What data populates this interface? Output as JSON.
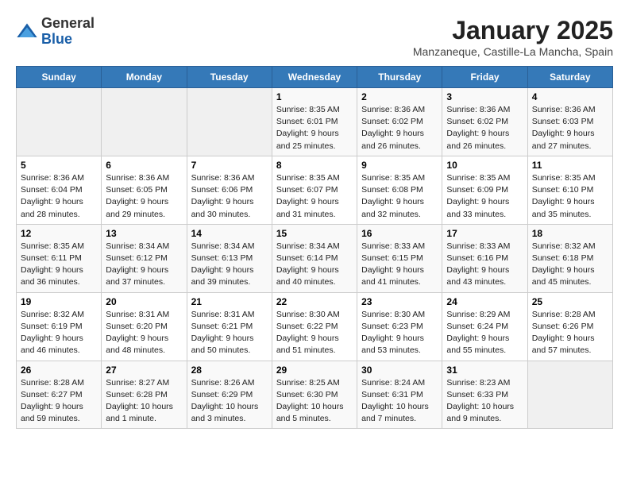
{
  "logo": {
    "general": "General",
    "blue": "Blue"
  },
  "title": "January 2025",
  "subtitle": "Manzaneque, Castille-La Mancha, Spain",
  "days_of_week": [
    "Sunday",
    "Monday",
    "Tuesday",
    "Wednesday",
    "Thursday",
    "Friday",
    "Saturday"
  ],
  "weeks": [
    [
      {
        "day": "",
        "info": ""
      },
      {
        "day": "",
        "info": ""
      },
      {
        "day": "",
        "info": ""
      },
      {
        "day": "1",
        "info": "Sunrise: 8:35 AM\nSunset: 6:01 PM\nDaylight: 9 hours\nand 25 minutes."
      },
      {
        "day": "2",
        "info": "Sunrise: 8:36 AM\nSunset: 6:02 PM\nDaylight: 9 hours\nand 26 minutes."
      },
      {
        "day": "3",
        "info": "Sunrise: 8:36 AM\nSunset: 6:02 PM\nDaylight: 9 hours\nand 26 minutes."
      },
      {
        "day": "4",
        "info": "Sunrise: 8:36 AM\nSunset: 6:03 PM\nDaylight: 9 hours\nand 27 minutes."
      }
    ],
    [
      {
        "day": "5",
        "info": "Sunrise: 8:36 AM\nSunset: 6:04 PM\nDaylight: 9 hours\nand 28 minutes."
      },
      {
        "day": "6",
        "info": "Sunrise: 8:36 AM\nSunset: 6:05 PM\nDaylight: 9 hours\nand 29 minutes."
      },
      {
        "day": "7",
        "info": "Sunrise: 8:36 AM\nSunset: 6:06 PM\nDaylight: 9 hours\nand 30 minutes."
      },
      {
        "day": "8",
        "info": "Sunrise: 8:35 AM\nSunset: 6:07 PM\nDaylight: 9 hours\nand 31 minutes."
      },
      {
        "day": "9",
        "info": "Sunrise: 8:35 AM\nSunset: 6:08 PM\nDaylight: 9 hours\nand 32 minutes."
      },
      {
        "day": "10",
        "info": "Sunrise: 8:35 AM\nSunset: 6:09 PM\nDaylight: 9 hours\nand 33 minutes."
      },
      {
        "day": "11",
        "info": "Sunrise: 8:35 AM\nSunset: 6:10 PM\nDaylight: 9 hours\nand 35 minutes."
      }
    ],
    [
      {
        "day": "12",
        "info": "Sunrise: 8:35 AM\nSunset: 6:11 PM\nDaylight: 9 hours\nand 36 minutes."
      },
      {
        "day": "13",
        "info": "Sunrise: 8:34 AM\nSunset: 6:12 PM\nDaylight: 9 hours\nand 37 minutes."
      },
      {
        "day": "14",
        "info": "Sunrise: 8:34 AM\nSunset: 6:13 PM\nDaylight: 9 hours\nand 39 minutes."
      },
      {
        "day": "15",
        "info": "Sunrise: 8:34 AM\nSunset: 6:14 PM\nDaylight: 9 hours\nand 40 minutes."
      },
      {
        "day": "16",
        "info": "Sunrise: 8:33 AM\nSunset: 6:15 PM\nDaylight: 9 hours\nand 41 minutes."
      },
      {
        "day": "17",
        "info": "Sunrise: 8:33 AM\nSunset: 6:16 PM\nDaylight: 9 hours\nand 43 minutes."
      },
      {
        "day": "18",
        "info": "Sunrise: 8:32 AM\nSunset: 6:18 PM\nDaylight: 9 hours\nand 45 minutes."
      }
    ],
    [
      {
        "day": "19",
        "info": "Sunrise: 8:32 AM\nSunset: 6:19 PM\nDaylight: 9 hours\nand 46 minutes."
      },
      {
        "day": "20",
        "info": "Sunrise: 8:31 AM\nSunset: 6:20 PM\nDaylight: 9 hours\nand 48 minutes."
      },
      {
        "day": "21",
        "info": "Sunrise: 8:31 AM\nSunset: 6:21 PM\nDaylight: 9 hours\nand 50 minutes."
      },
      {
        "day": "22",
        "info": "Sunrise: 8:30 AM\nSunset: 6:22 PM\nDaylight: 9 hours\nand 51 minutes."
      },
      {
        "day": "23",
        "info": "Sunrise: 8:30 AM\nSunset: 6:23 PM\nDaylight: 9 hours\nand 53 minutes."
      },
      {
        "day": "24",
        "info": "Sunrise: 8:29 AM\nSunset: 6:24 PM\nDaylight: 9 hours\nand 55 minutes."
      },
      {
        "day": "25",
        "info": "Sunrise: 8:28 AM\nSunset: 6:26 PM\nDaylight: 9 hours\nand 57 minutes."
      }
    ],
    [
      {
        "day": "26",
        "info": "Sunrise: 8:28 AM\nSunset: 6:27 PM\nDaylight: 9 hours\nand 59 minutes."
      },
      {
        "day": "27",
        "info": "Sunrise: 8:27 AM\nSunset: 6:28 PM\nDaylight: 10 hours\nand 1 minute."
      },
      {
        "day": "28",
        "info": "Sunrise: 8:26 AM\nSunset: 6:29 PM\nDaylight: 10 hours\nand 3 minutes."
      },
      {
        "day": "29",
        "info": "Sunrise: 8:25 AM\nSunset: 6:30 PM\nDaylight: 10 hours\nand 5 minutes."
      },
      {
        "day": "30",
        "info": "Sunrise: 8:24 AM\nSunset: 6:31 PM\nDaylight: 10 hours\nand 7 minutes."
      },
      {
        "day": "31",
        "info": "Sunrise: 8:23 AM\nSunset: 6:33 PM\nDaylight: 10 hours\nand 9 minutes."
      },
      {
        "day": "",
        "info": ""
      }
    ]
  ]
}
